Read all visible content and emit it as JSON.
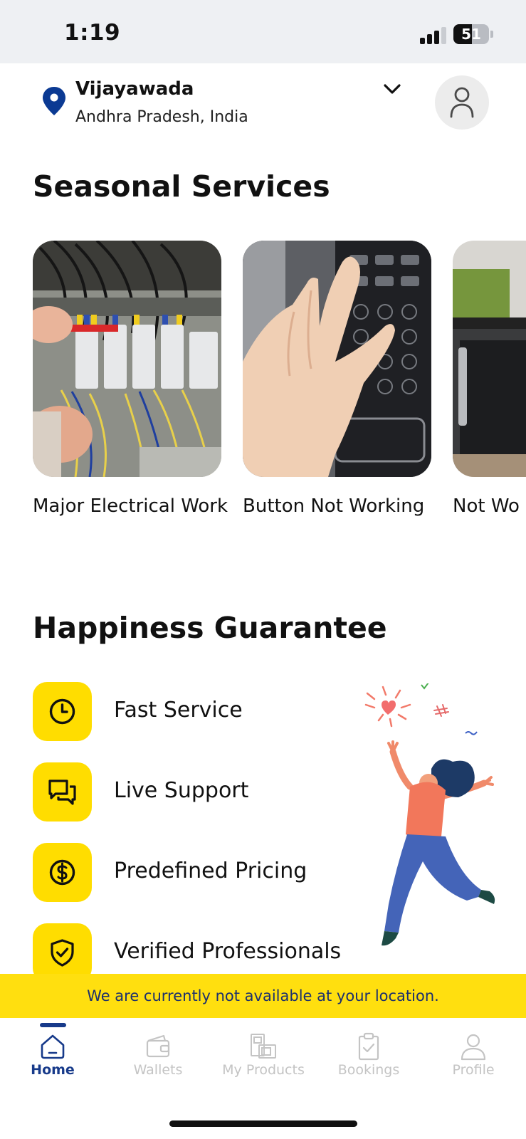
{
  "status_bar": {
    "time": "1:19",
    "battery": "51",
    "battery_level": 0.51,
    "signal_bars": 3
  },
  "location": {
    "city": "Vijayawada",
    "region": "Andhra Pradesh, India"
  },
  "seasonal": {
    "title": "Seasonal Services",
    "cards": [
      {
        "label": "Major Electrical Work",
        "image": "electrical-panel-photo"
      },
      {
        "label": "Button Not Working",
        "image": "microwave-keypad-photo"
      },
      {
        "label": "Not Wo Conditi",
        "image": "microwave-oven-photo"
      }
    ]
  },
  "happiness": {
    "title": "Happiness Guarantee",
    "features": [
      {
        "label": "Fast Service",
        "icon": "clock-icon"
      },
      {
        "label": "Live Support",
        "icon": "chat-icon"
      },
      {
        "label": "Predefined Pricing",
        "icon": "dollar-coin-icon"
      },
      {
        "label": "Verified Professionals",
        "icon": "shield-check-icon"
      }
    ]
  },
  "banner": {
    "text": "We are currently not available at your location."
  },
  "nav": {
    "items": [
      {
        "label": "Home",
        "icon": "home-icon",
        "active": true
      },
      {
        "label": "Wallets",
        "icon": "wallet-icon",
        "active": false
      },
      {
        "label": "My Products",
        "icon": "products-icon",
        "active": false
      },
      {
        "label": "Bookings",
        "icon": "clipboard-icon",
        "active": false
      },
      {
        "label": "Profile",
        "icon": "person-icon",
        "active": false
      }
    ]
  },
  "colors": {
    "accent_yellow": "#ffdd00",
    "brand_blue": "#173a8a",
    "pin_blue": "#0b3a93"
  }
}
